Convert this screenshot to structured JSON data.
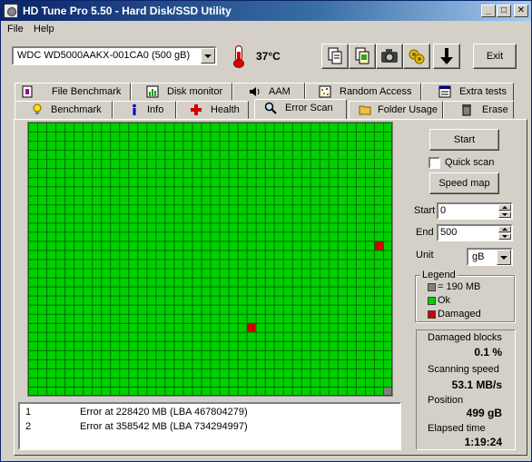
{
  "window": {
    "title": "HD Tune Pro 5.50 - Hard Disk/SSD Utility",
    "controls": {
      "minimize": "_",
      "maximize": "□",
      "close": "✕"
    }
  },
  "menu": {
    "items": [
      "File",
      "Help"
    ]
  },
  "toolbar": {
    "drive": "WDC WD5000AAKX-001CA0 (500 gB)",
    "temperature": "37°C",
    "exit_label": "Exit",
    "icons": [
      "copy-text-icon",
      "copy-screenshot-icon",
      "camera-icon",
      "options-icon",
      "save-down-arrow-icon"
    ]
  },
  "tabs": {
    "row1": [
      {
        "label": "File Benchmark",
        "icon": "file-benchmark-icon"
      },
      {
        "label": "Disk monitor",
        "icon": "disk-monitor-icon"
      },
      {
        "label": "AAM",
        "icon": "speaker-icon"
      },
      {
        "label": "Random Access",
        "icon": "random-access-icon"
      },
      {
        "label": "Extra tests",
        "icon": "extra-tests-icon"
      }
    ],
    "row2": [
      {
        "label": "Benchmark",
        "icon": "lightbulb-icon"
      },
      {
        "label": "Info",
        "icon": "info-icon"
      },
      {
        "label": "Health",
        "icon": "health-cross-icon"
      },
      {
        "label": "Error Scan",
        "icon": "magnifier-icon",
        "active": true
      },
      {
        "label": "Folder Usage",
        "icon": "folder-icon"
      },
      {
        "label": "Erase",
        "icon": "trash-icon"
      }
    ]
  },
  "scan": {
    "grid_cols": 40,
    "grid_rows": 30,
    "damaged_cells": [
      [
        38,
        13
      ],
      [
        24,
        22
      ]
    ],
    "pending_cells": [
      [
        39,
        29
      ]
    ],
    "colors": {
      "ok": "#00d000",
      "damaged": "#d00000",
      "grid": "#007000",
      "pending": "#808080"
    }
  },
  "log": [
    {
      "num": "1",
      "msg": "Error at 228420 MB (LBA 467804279)"
    },
    {
      "num": "2",
      "msg": "Error at 358542 MB (LBA 734294997)"
    }
  ],
  "controls": {
    "start_label": "Start",
    "quick_scan_label": "Quick scan",
    "quick_scan_checked": false,
    "speed_map_label": "Speed map",
    "start_field_label": "Start",
    "start_value": "0",
    "end_field_label": "End",
    "end_value": "500",
    "unit_label": "Unit",
    "unit_value": "gB"
  },
  "legend": {
    "title": "Legend",
    "items": [
      {
        "label": "= 190 MB",
        "color": "#808080"
      },
      {
        "label": "Ok",
        "color": "#00d000"
      },
      {
        "label": "Damaged",
        "color": "#d00000"
      }
    ]
  },
  "stats": {
    "damaged_blocks_label": "Damaged blocks",
    "damaged_blocks_value": "0.1 %",
    "scanning_speed_label": "Scanning speed",
    "scanning_speed_value": "53.1 MB/s",
    "position_label": "Position",
    "position_value": "499 gB",
    "elapsed_label": "Elapsed time",
    "elapsed_value": "1:19:24"
  }
}
